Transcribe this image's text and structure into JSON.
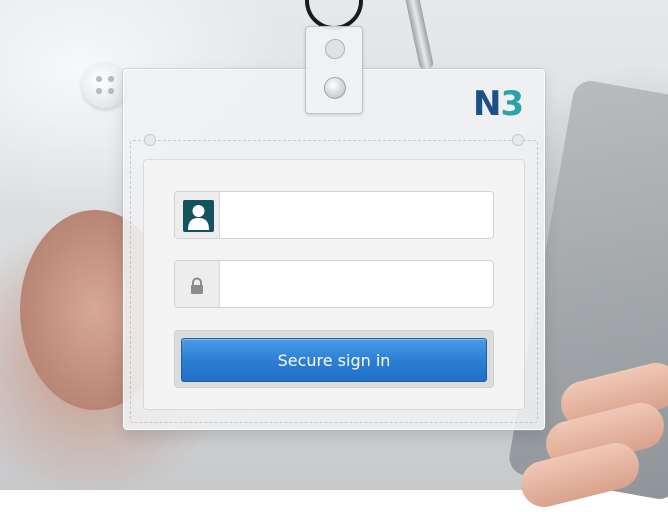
{
  "logo": {
    "n": "N",
    "three": "3"
  },
  "username": {
    "value": "",
    "placeholder": ""
  },
  "password": {
    "value": "",
    "placeholder": ""
  },
  "signin": {
    "label": "Secure sign in"
  },
  "colors": {
    "button": "#2d7fd6",
    "logo_n": "#1d4f8a",
    "logo_3": "#2ba3a8",
    "user_icon_bg": "#14525f"
  },
  "icons": {
    "username": "user-silhouette-icon",
    "password": "lock-icon",
    "clip": "badge-clip-icon"
  }
}
